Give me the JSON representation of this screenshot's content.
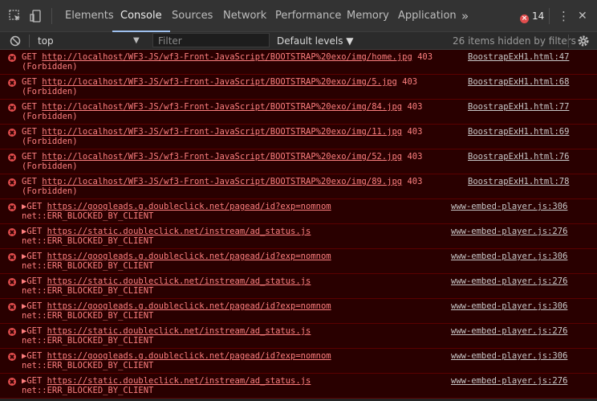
{
  "tabs": [
    "Elements",
    "Console",
    "Sources",
    "Network",
    "Performance",
    "Memory",
    "Application"
  ],
  "more_tabs": "»",
  "error_count": "14",
  "menu_glyph": "⋮",
  "close_glyph": "✕",
  "toolbar": {
    "context": "top",
    "filter_placeholder": "Filter",
    "levels": "Default levels ▼",
    "hidden": "26 items hidden by filters"
  },
  "rows": [
    {
      "prefix": "GET ",
      "url": "http://localhost/WF3-JS/wf3-Front-JavaScript/BOOTSTRAP%20exo/img/home.jpg",
      "status": " 403",
      "line2": "(Forbidden)",
      "source": "BoostrapExH1.html:47"
    },
    {
      "prefix": "GET ",
      "url": "http://localhost/WF3-JS/wf3-Front-JavaScript/BOOTSTRAP%20exo/img/5.jpg",
      "status": " 403",
      "line2": "(Forbidden)",
      "source": "BoostrapExH1.html:68"
    },
    {
      "prefix": "GET ",
      "url": "http://localhost/WF3-JS/wf3-Front-JavaScript/BOOTSTRAP%20exo/img/84.jpg",
      "status": " 403",
      "line2": "(Forbidden)",
      "source": "BoostrapExH1.html:77"
    },
    {
      "prefix": "GET ",
      "url": "http://localhost/WF3-JS/wf3-Front-JavaScript/BOOTSTRAP%20exo/img/11.jpg",
      "status": " 403",
      "line2": "(Forbidden)",
      "source": "BoostrapExH1.html:69"
    },
    {
      "prefix": "GET ",
      "url": "http://localhost/WF3-JS/wf3-Front-JavaScript/BOOTSTRAP%20exo/img/52.jpg",
      "status": " 403",
      "line2": "(Forbidden)",
      "source": "BoostrapExH1.html:76"
    },
    {
      "prefix": "GET ",
      "url": "http://localhost/WF3-JS/wf3-Front-JavaScript/BOOTSTRAP%20exo/img/89.jpg",
      "status": " 403",
      "line2": "(Forbidden)",
      "source": "BoostrapExH1.html:78"
    },
    {
      "prefix": "▶GET ",
      "url": "https://googleads.g.doubleclick.net/pagead/id?exp=nomnom",
      "status": "",
      "line2": "net::ERR_BLOCKED_BY_CLIENT",
      "source": "www-embed-player.js:306"
    },
    {
      "prefix": "▶GET ",
      "url": "https://static.doubleclick.net/instream/ad_status.js",
      "status": "",
      "line2": "net::ERR_BLOCKED_BY_CLIENT",
      "source": "www-embed-player.js:276"
    },
    {
      "prefix": "▶GET ",
      "url": "https://googleads.g.doubleclick.net/pagead/id?exp=nomnom",
      "status": "",
      "line2": "net::ERR_BLOCKED_BY_CLIENT",
      "source": "www-embed-player.js:306"
    },
    {
      "prefix": "▶GET ",
      "url": "https://static.doubleclick.net/instream/ad_status.js",
      "status": "",
      "line2": "net::ERR_BLOCKED_BY_CLIENT",
      "source": "www-embed-player.js:276"
    },
    {
      "prefix": "▶GET ",
      "url": "https://googleads.g.doubleclick.net/pagead/id?exp=nomnom",
      "status": "",
      "line2": "net::ERR_BLOCKED_BY_CLIENT",
      "source": "www-embed-player.js:306"
    },
    {
      "prefix": "▶GET ",
      "url": "https://static.doubleclick.net/instream/ad_status.js",
      "status": "",
      "line2": "net::ERR_BLOCKED_BY_CLIENT",
      "source": "www-embed-player.js:276"
    },
    {
      "prefix": "▶GET ",
      "url": "https://googleads.g.doubleclick.net/pagead/id?exp=nomnom",
      "status": "",
      "line2": "net::ERR_BLOCKED_BY_CLIENT",
      "source": "www-embed-player.js:306"
    },
    {
      "prefix": "▶GET ",
      "url": "https://static.doubleclick.net/instream/ad_status.js",
      "status": "",
      "line2": "net::ERR_BLOCKED_BY_CLIENT",
      "source": "www-embed-player.js:276"
    }
  ],
  "colors": {
    "error_bg": "#290000",
    "error_text": "#fe7f7f",
    "accent": "#9ec0ee"
  },
  "icons": [
    "inspect-element-icon",
    "device-toggle-icon",
    "clear-console-icon",
    "settings-gear-icon",
    "error-icon"
  ]
}
